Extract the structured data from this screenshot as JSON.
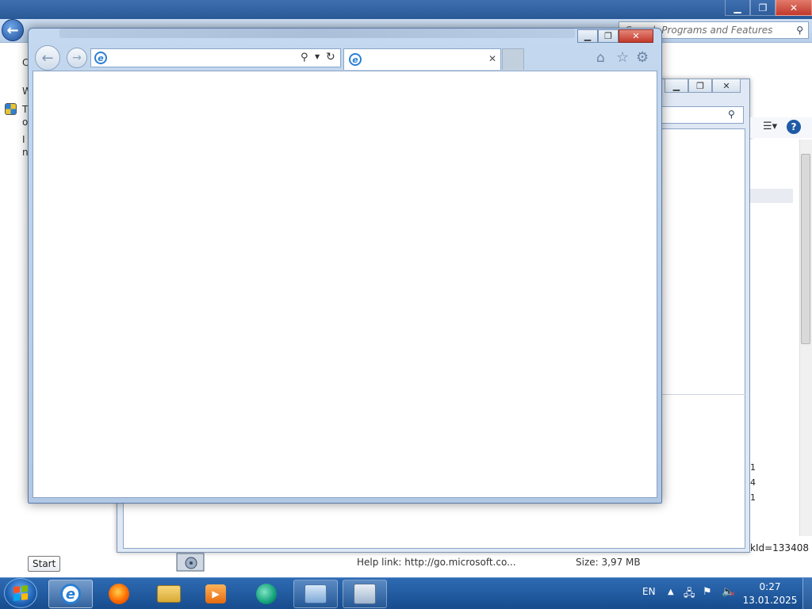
{
  "control_panel": {
    "search_placeholder": "Search Programs and Features",
    "left_lines": [
      "C",
      "W",
      "T",
      "o",
      "I",
      "n"
    ],
    "size_values": [
      "1",
      "4",
      "1"
    ],
    "link_id_text": "kId=133408",
    "help_link_label": "Help link:",
    "help_link_value": "http://go.microsoft.co...",
    "size_label": "Size:",
    "size_value": "3,97 MB"
  },
  "ie": {
    "address_value": "",
    "tab_title": ""
  },
  "tooltip": {
    "text": "Start"
  },
  "taskbar": {
    "language": "EN",
    "time": "0:27",
    "date": "13.01.2025",
    "pinned": [
      "internet-explorer",
      "firefox",
      "windows-explorer",
      "media-player",
      "app",
      "control-panel",
      "setup"
    ]
  },
  "colors": {
    "taskbar": "#1f5aa0",
    "ie_close": "#c4392a",
    "accent": "#2a7fd4"
  }
}
